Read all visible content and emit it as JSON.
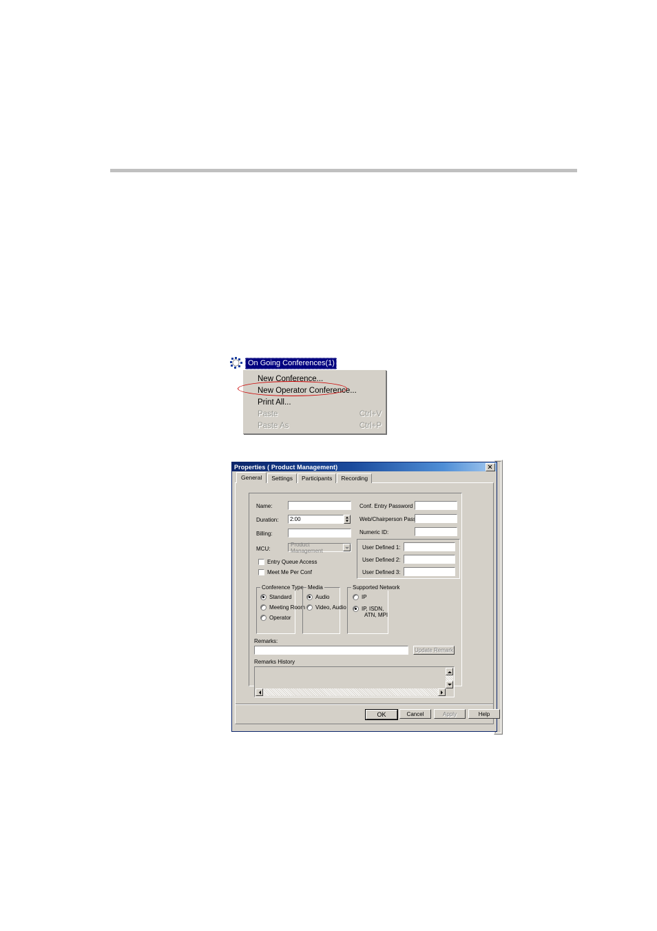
{
  "page": {
    "background": "#ffffff",
    "rule_color": "#c0c0c0"
  },
  "tree": {
    "icon": "conferences-gear-icon",
    "selected_label": "On Going Conferences(1)",
    "highlight_color": "#000080"
  },
  "context_menu": {
    "items": [
      {
        "label": "New Conference...",
        "accel": "",
        "disabled": false,
        "highlighted": true
      },
      {
        "label": "New Operator Conference...",
        "accel": "",
        "disabled": false,
        "highlighted": false
      },
      {
        "label": "Print All...",
        "accel": "",
        "disabled": false,
        "highlighted": false
      },
      {
        "label": "Paste",
        "accel": "Ctrl+V",
        "disabled": true,
        "highlighted": false
      },
      {
        "label": "Paste As",
        "accel": "Ctrl+P",
        "disabled": true,
        "highlighted": false
      }
    ],
    "annotation_color": "#cc0000"
  },
  "dialog": {
    "title": "Properties  ( Product Management)",
    "close_icon": "close-icon",
    "tabs": [
      {
        "label": "General",
        "active": true
      },
      {
        "label": "Settings",
        "active": false
      },
      {
        "label": "Participants",
        "active": false
      },
      {
        "label": "Recording",
        "active": false
      }
    ],
    "left_fields": {
      "name_label": "Name:",
      "name_value": "",
      "duration_label": "Duration:",
      "duration_value": "2:00",
      "billing_label": "Billing:",
      "billing_value": "",
      "mcu_label": "MCU:",
      "mcu_value": "Product Management"
    },
    "checkboxes": [
      {
        "label": "Entry Queue Access",
        "checked": false
      },
      {
        "label": "Meet Me Per Conf",
        "checked": false
      }
    ],
    "right_fields": {
      "conf_entry_password_label": "Conf. Entry Password :",
      "conf_entry_password_value": "",
      "web_chairperson_password_label": "Web/Chairperson Password:",
      "web_chairperson_password_value": "",
      "numeric_id_label": "Numeric ID:",
      "numeric_id_value": ""
    },
    "user_defined": [
      {
        "label": "User Defined 1:",
        "value": ""
      },
      {
        "label": "User Defined 2:",
        "value": ""
      },
      {
        "label": "User Defined 3:",
        "value": ""
      }
    ],
    "conference_type": {
      "title": "Conference Type",
      "options": [
        {
          "label": "Standard",
          "selected": true
        },
        {
          "label": "Meeting Room",
          "selected": false
        },
        {
          "label": "Operator",
          "selected": false
        }
      ]
    },
    "media": {
      "title": "Media",
      "options": [
        {
          "label": "Audio",
          "selected": true
        },
        {
          "label": "Video, Audio",
          "selected": false
        }
      ]
    },
    "supported_network": {
      "title": "Supported Network",
      "options": [
        {
          "label": "IP",
          "selected": false
        },
        {
          "label": "IP, ISDN,",
          "label2": "ATN, MPI",
          "selected": true
        }
      ]
    },
    "remarks": {
      "label": "Remarks:",
      "value": "",
      "update_button": "Update Remark",
      "update_button_disabled": true,
      "history_label": "Remarks History",
      "history_value": ""
    },
    "footer_buttons": [
      {
        "label": "OK",
        "disabled": false,
        "default": true
      },
      {
        "label": "Cancel",
        "disabled": false,
        "default": false
      },
      {
        "label": "Apply",
        "disabled": true,
        "default": false
      },
      {
        "label": "Help",
        "disabled": false,
        "default": false
      }
    ]
  }
}
